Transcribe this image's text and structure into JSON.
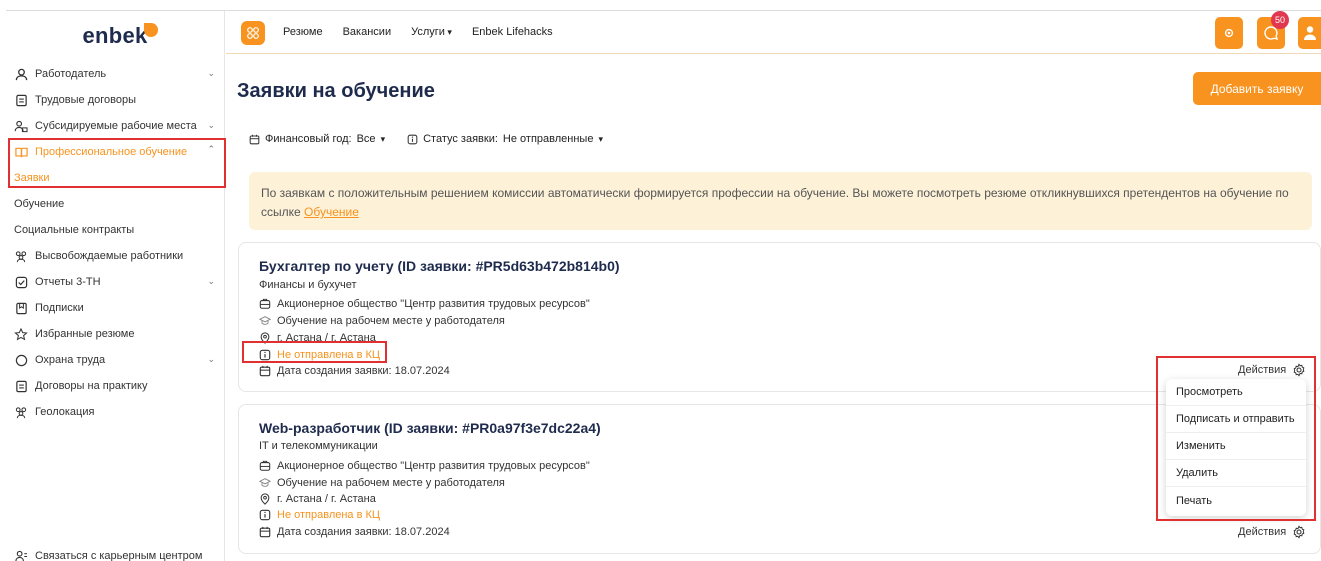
{
  "sidebar": {
    "logo": "enbek",
    "items": [
      {
        "label": "Работодатель",
        "icon": "user-icon",
        "chevron": true
      },
      {
        "label": "Трудовые договоры",
        "icon": "document-icon"
      },
      {
        "label": "Субсидируемые рабочие места",
        "icon": "users-icon",
        "chevron": true
      },
      {
        "label": "Профессиональное обучение",
        "icon": "book-icon",
        "chevron": true,
        "active": true
      },
      {
        "label": "Заявки",
        "sub": true,
        "active": true
      },
      {
        "label": "Обучение",
        "sub": true
      },
      {
        "label": "Социальные контракты",
        "sub": true
      },
      {
        "label": "Высвобождаемые работники",
        "icon": "group-icon"
      },
      {
        "label": "Отчеты 3-ТН",
        "icon": "check-square-icon",
        "chevron": true
      },
      {
        "label": "Подписки",
        "icon": "bookmark-icon"
      },
      {
        "label": "Избранные резюме",
        "icon": "star-icon"
      },
      {
        "label": "Охрана труда",
        "icon": "circle-icon",
        "chevron": true
      },
      {
        "label": "Договоры на практику",
        "icon": "document-icon"
      },
      {
        "label": "Геолокация",
        "icon": "group-icon"
      }
    ],
    "contact": "Связаться с карьерным центром"
  },
  "topbar": {
    "nav": [
      "Резюме",
      "Вакансии",
      "Услуги",
      "Enbek Lifehacks"
    ],
    "notifications_count": "50"
  },
  "main": {
    "title": "Заявки на обучение",
    "add_button": "Добавить заявку",
    "filter_year_label": "Финансовый год:",
    "filter_year_value": "Все",
    "filter_status_label": "Статус заявки:",
    "filter_status_value": "Не отправленные",
    "notice_text": "По заявкам с положительным решением комиссии автоматически формируется профессии на обучение. Вы можете посмотреть резюме откликнувшихся претендентов на обучение по ссылке ",
    "notice_link": "Обучение"
  },
  "cards": [
    {
      "title": "Бухгалтер по учету (ID заявки: #PR5d63b472b814b0)",
      "category": "Финансы и бухучет",
      "organization": "Акционерное общество \"Центр развития трудовых ресурсов\"",
      "training": "Обучение на рабочем месте у работодателя",
      "location": "г. Астана / г. Астана",
      "status": "Не отправлена в КЦ",
      "date": "Дата создания заявки: 18.07.2024",
      "actions": "Действия"
    },
    {
      "title": "Web-разработчик (ID заявки: #PR0a97f3e7dc22a4)",
      "category": "IT и телекоммуникации",
      "organization": "Акционерное общество \"Центр развития трудовых ресурсов\"",
      "training": "Обучение на рабочем месте у работодателя",
      "location": "г. Астана / г. Астана",
      "status": "Не отправлена в КЦ",
      "date": "Дата создания заявки: 18.07.2024",
      "actions": "Действия"
    }
  ],
  "actions_menu": [
    "Просмотреть",
    "Подписать и отправить",
    "Изменить",
    "Удалить",
    "Печать"
  ],
  "colors": {
    "accent": "#f7931e",
    "highlight_box": "#e03030",
    "notice_bg": "#fdf1d8"
  }
}
